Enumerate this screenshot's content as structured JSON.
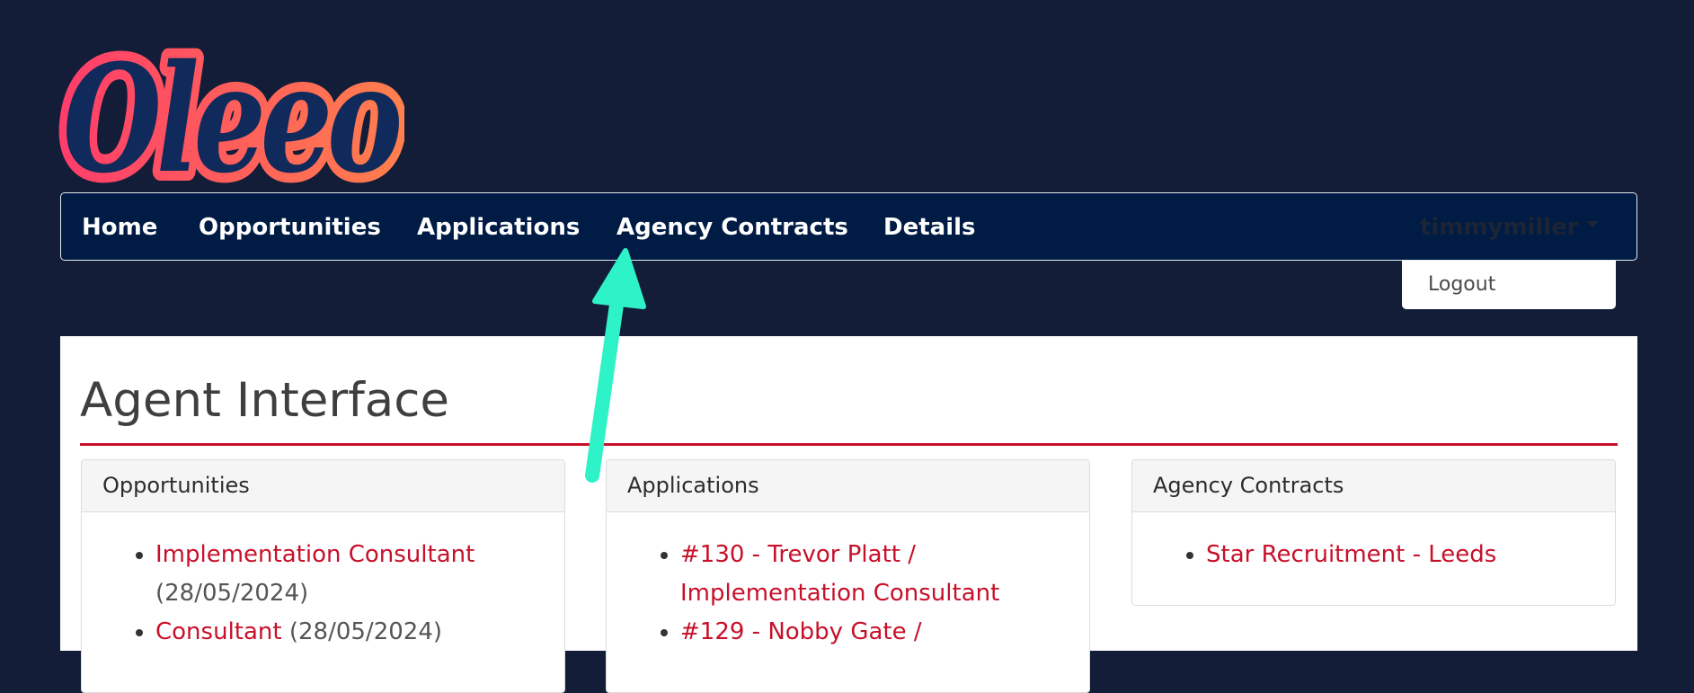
{
  "logo": {
    "text": "Oleeo"
  },
  "nav": {
    "items": [
      {
        "label": "Home"
      },
      {
        "label": "Opportunities"
      },
      {
        "label": "Applications"
      },
      {
        "label": "Agency Contracts"
      },
      {
        "label": "Details"
      }
    ],
    "user": "timmymiller",
    "dropdown": {
      "logout_label": "Logout"
    }
  },
  "main": {
    "title": "Agent Interface",
    "cards": {
      "opportunities": {
        "header": "Opportunities",
        "items": [
          {
            "link": "Implementation Consultant",
            "date": "(28/05/2024)"
          },
          {
            "link": "Consultant",
            "date": "(28/05/2024)"
          }
        ]
      },
      "applications": {
        "header": "Applications",
        "items": [
          {
            "link": "#130 - Trevor Platt / Implementation Consultant"
          },
          {
            "link": "#129 - Nobby Gate /"
          }
        ]
      },
      "agency_contracts": {
        "header": "Agency Contracts",
        "items": [
          {
            "link": "Star Recruitment - Leeds"
          }
        ]
      }
    }
  },
  "colors": {
    "page_background": "#131d38",
    "navbar_background": "#001b44",
    "accent_red": "#c7102a",
    "annotation_arrow": "#2ef2c8",
    "logo_gradient_start": "#ff3d6a",
    "logo_gradient_end": "#ff7f4d"
  }
}
